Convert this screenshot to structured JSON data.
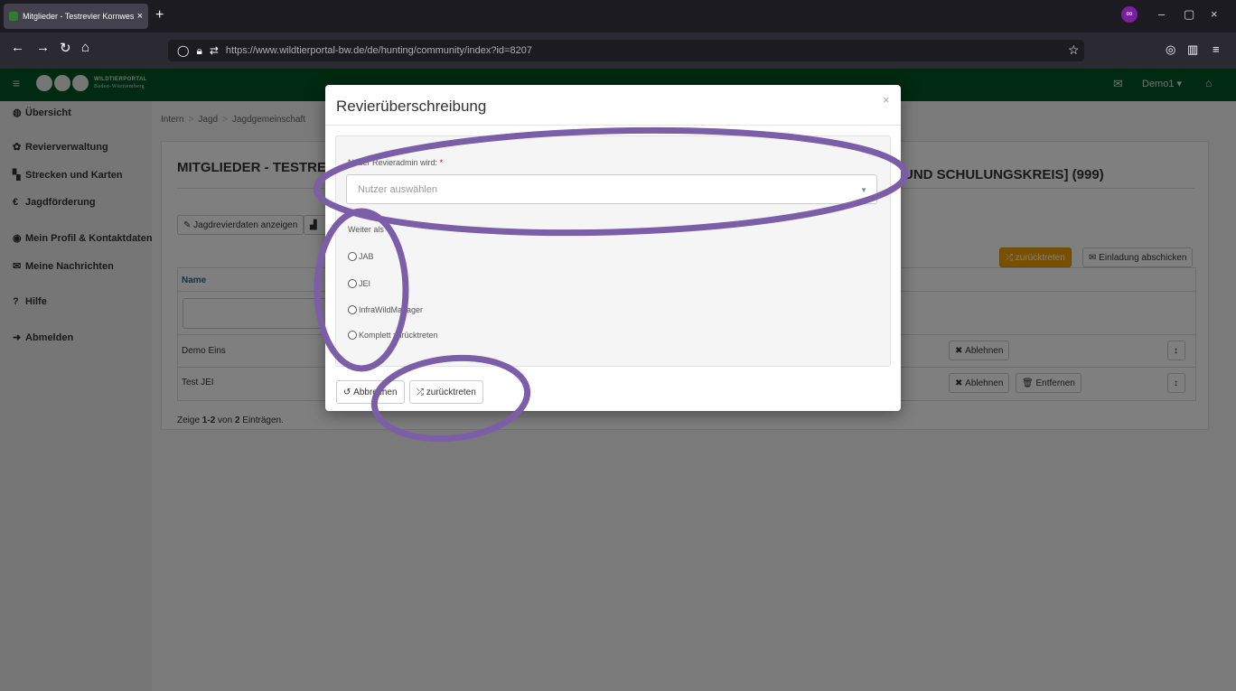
{
  "browser": {
    "tab_title": "Mitglieder - Testrevier Kornwest",
    "tab_close": "×",
    "new_tab": "+",
    "url_host": "https://www.wildtierportal-bw.de",
    "url_path": "/de/hunting/community/index?id=8207",
    "window_controls": [
      "–",
      "▢",
      "×"
    ]
  },
  "app": {
    "logo_line1": "WILDTIERPORTAL",
    "logo_line2": "Baden-Württemberg",
    "user_label": "Demo1 ▾",
    "colors": {
      "header": "#005522",
      "warning": "#f0a000",
      "annotation": "#7b5ea7"
    }
  },
  "sidebar": {
    "items": [
      {
        "icon": "dashboard-icon",
        "glyph": "◍",
        "label": "Übersicht"
      },
      {
        "icon": "gear-icon",
        "glyph": "✿",
        "label": "Revierverwaltung"
      },
      {
        "icon": "map-icon",
        "glyph": "▚",
        "label": "Strecken und Karten"
      },
      {
        "icon": "euro-icon",
        "glyph": "€",
        "label": "Jagdförderung"
      },
      {
        "icon": "user-icon",
        "glyph": "◉",
        "label": "Mein Profil & Kontaktdaten"
      },
      {
        "icon": "envelope-icon",
        "glyph": "✉",
        "label": "Meine Nachrichten"
      },
      {
        "icon": "help-icon",
        "glyph": "?",
        "label": "Hilfe"
      },
      {
        "icon": "logout-icon",
        "glyph": "➜",
        "label": "Abmelden"
      }
    ]
  },
  "breadcrumb": [
    "Intern",
    "Jagd",
    "Jagdgemeinschaft"
  ],
  "page": {
    "title_left": "MITGLIEDER - TESTREV",
    "title_right": "UND SCHULUNGSKREIS] (999)",
    "btn_show_data": "Jagdrevierdaten anzeigen",
    "btn_zuruecktreten": "zurücktreten",
    "btn_invite": "Einladung abschicken",
    "table_header_name": "Name",
    "rows": [
      {
        "name": "Demo Eins",
        "reject": "Ablehnen"
      },
      {
        "name": "Test JEI",
        "reject": "Ablehnen",
        "remove": "Entfernen"
      }
    ],
    "summary_prefix": "Zeige ",
    "summary_range": "1-2",
    "summary_mid": " von ",
    "summary_total": "2",
    "summary_suffix": " Einträgen."
  },
  "modal": {
    "title": "Revierüberschreibung",
    "close": "×",
    "field_label": "Neuer Revieradmin wird:",
    "required_mark": "*",
    "select_placeholder": "Nutzer auswählen",
    "radio_group_label": "Weiter als",
    "radio_options": [
      "JAB",
      "JEI",
      "InfraWildManager",
      "Komplett zurücktreten"
    ],
    "btn_cancel": "Abbrechen",
    "btn_confirm": "zurücktreten"
  }
}
